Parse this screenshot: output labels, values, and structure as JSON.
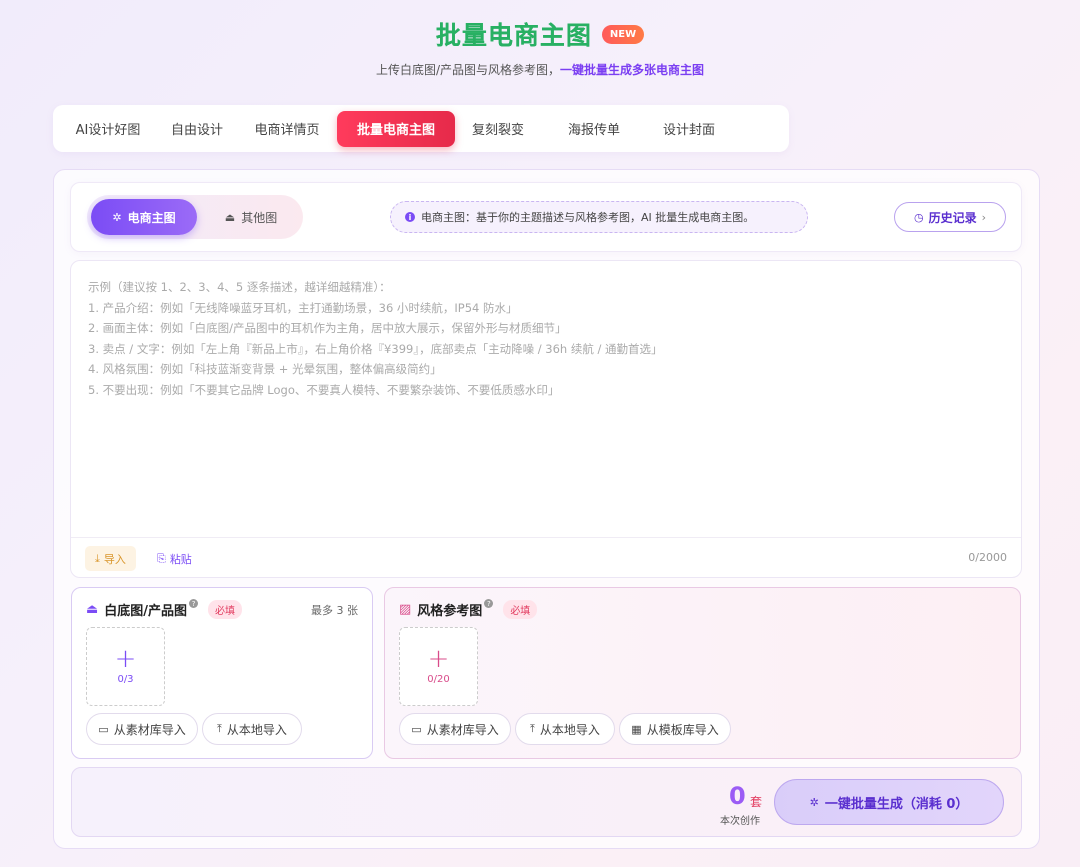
{
  "header": {
    "title": "批量电商主图",
    "badge": "NEW",
    "subtitle_prefix": "上传白底图/产品图与风格参考图，",
    "subtitle_highlight": "一键批量生成多张电商主图"
  },
  "top_tabs": [
    {
      "label": "AI设计好图"
    },
    {
      "label": "自由设计"
    },
    {
      "label": "电商详情页"
    },
    {
      "label": "批量电商主图",
      "active": true
    },
    {
      "label": "复刻裂变"
    },
    {
      "label": "海报传单"
    },
    {
      "label": "设计封面"
    }
  ],
  "mode": {
    "options": [
      {
        "label": "电商主图",
        "icon": "sparkle-icon",
        "active": true
      },
      {
        "label": "其他图",
        "icon": "bag-icon"
      }
    ],
    "info": "电商主图：基于你的主题描述与风格参考图，AI 批量生成电商主图。",
    "history_label": "历史记录"
  },
  "prompt": {
    "placeholder_lines": [
      "示例（建议按 1、2、3、4、5 逐条描述，越详细越精准）：",
      "1. 产品介绍：例如「无线降噪蓝牙耳机，主打通勤场景，36 小时续航，IP54 防水」",
      "2. 画面主体：例如「白底图/产品图中的耳机作为主角，居中放大展示，保留外形与材质细节」",
      "3. 卖点 / 文字：例如「左上角『新品上市』，右上角价格『¥399』，底部卖点「主动降噪 / 36h 续航 / 通勤首选」",
      "4. 风格氛围：例如「科技蓝渐变背景 + 光晕氛围，整体偏高级简约」",
      "5. 不要出现：例如「不要其它品牌 Logo、不要真人模特、不要繁杂装饰、不要低质感水印」"
    ],
    "import_label": "导入",
    "paste_label": "粘贴",
    "char_count": "0/2000"
  },
  "product_upload": {
    "title": "白底图/产品图",
    "help": "?",
    "required": "必填",
    "max_note": "最多 3 张",
    "count": "0/3",
    "sources": [
      "从素材库导入",
      "从本地导入"
    ]
  },
  "style_upload": {
    "title": "风格参考图",
    "help": "?",
    "required": "必填",
    "count": "0/20",
    "sources": [
      "从素材库导入",
      "从本地导入",
      "从模板库导入"
    ]
  },
  "generate": {
    "count": "0",
    "unit": "套",
    "label": "本次创作",
    "button": "一键批量生成（消耗 0）"
  },
  "colors": {
    "accent": "#7b4cf5",
    "active_tab": "#e62a4a",
    "title_green": "#28b063",
    "required_red": "#e23a5e"
  }
}
